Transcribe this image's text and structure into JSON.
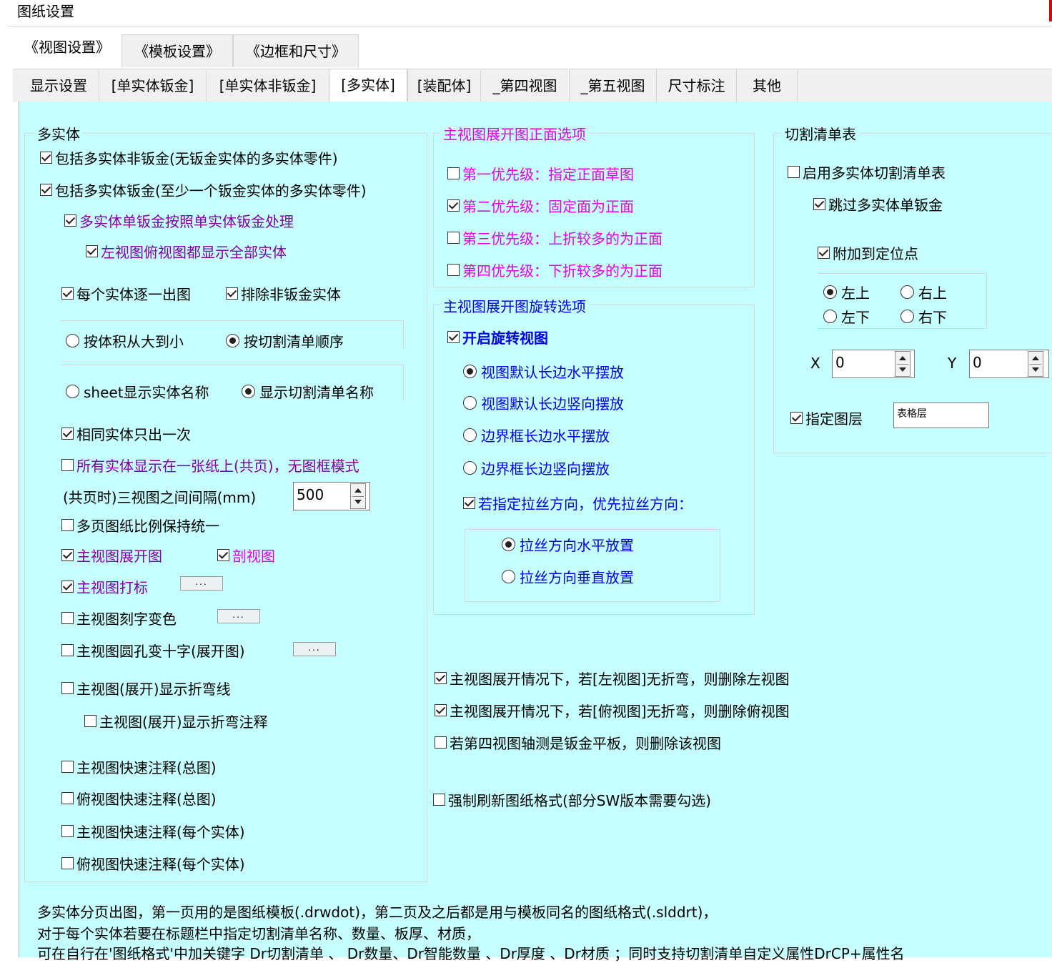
{
  "window": {
    "title": "图纸设置"
  },
  "tabs_top": [
    "《视图设置》",
    "《模板设置》",
    "《边框和尺寸》"
  ],
  "tabs_sub": [
    "显示设置",
    "[单实体钣金]",
    "[单实体非钣金]",
    "[多实体]",
    "[装配体]",
    "_第四视图",
    "_第五视图",
    "尺寸标注",
    "其他"
  ],
  "multi": {
    "title": "多实体",
    "inc_nonsheet": "包括多实体非钣金(无钣金实体的多实体零件)",
    "inc_sheet": "包括多实体钣金(至少一个钣金实体的多实体零件)",
    "single_sheet_as": "多实体单钣金按照单实体钣金处理",
    "left_top_all": "左视图俯视图都显示全部实体",
    "each_body": "每个实体逐一出图",
    "exclude_nonsheet": "排除非钣金实体",
    "order_volume": "按体积从大到小",
    "order_cutlist": "按切割清单顺序",
    "show_sheet_name": "sheet显示实体名称",
    "show_cutlist_name": "显示切割清单名称",
    "same_once": "相同实体只出一次",
    "all_one_sheet": "所有实体显示在一张纸上(共页)，无图框模式",
    "gap_label": "(共页时)三视图之间间隔(mm)",
    "gap_value": "500",
    "keep_scale": "多页图纸比例保持统一",
    "main_flat": "主视图展开图",
    "section": "剖视图",
    "main_mark": "主视图打标",
    "main_engrave": "主视图刻字变色",
    "main_hole_cross": "主视图圆孔变十字(展开图)",
    "main_bendline": "主视图(展开)显示折弯线",
    "main_bendnote": "主视图(展开)显示折弯注释",
    "main_quick_total": "主视图快速注释(总图)",
    "top_quick_total": "俯视图快速注释(总图)",
    "main_quick_each": "主视图快速注释(每个实体)",
    "top_quick_each": "俯视图快速注释(每个实体)",
    "ellipsis": "..."
  },
  "front": {
    "title": "主视图展开图正面选项",
    "p1": "第一优先级：指定正面草图",
    "p2": "第二优先级：固定面为正面",
    "p3": "第三优先级：上折较多的为正面",
    "p4": "第四优先级：下折较多的为正面"
  },
  "rotate": {
    "title": "主视图展开图旋转选项",
    "enable": "开启旋转视图",
    "r1": "视图默认长边水平摆放",
    "r2": "视图默认长边竖向摆放",
    "r3": "边界框长边水平摆放",
    "r4": "边界框长边竖向摆放",
    "grain": "若指定拉丝方向，优先拉丝方向：",
    "g1": "拉丝方向水平放置",
    "g2": "拉丝方向垂直放置"
  },
  "extra": {
    "del_left": "主视图展开情况下，若[左视图]无折弯，则删除左视图",
    "del_top": "主视图展开情况下，若[俯视图]无折弯，则删除俯视图",
    "del_fourth": "若第四视图轴测是钣金平板，则删除该视图",
    "force_refresh": "强制刷新图纸格式(部分SW版本需要勾选)"
  },
  "cutlist": {
    "title": "切割清单表",
    "enable": "启用多实体切割清单表",
    "skip_single": "跳过多实体单钣金",
    "attach": "附加到定位点",
    "tl": "左上",
    "tr": "右上",
    "bl": "左下",
    "br": "右下",
    "x_label": "X",
    "x_value": "0",
    "y_label": "Y",
    "y_value": "0",
    "layer_label": "指定图层",
    "layer_value": "表格层"
  },
  "notes": [
    "多实体分页出图，第一页用的是图纸模板(.drwdot)，第二页及之后都是用与模板同名的图纸格式(.slddrt)，",
    "对于每个实体若要在标题栏中指定切割清单名称、数量、板厚、材质，",
    "可在自行在'图纸格式'中加关键字  Dr切割清单  、 Dr数量、Dr智能数量  、Dr厚度  、Dr材质 ；同时支持切割清单自定义属性DrCP+属性名"
  ]
}
